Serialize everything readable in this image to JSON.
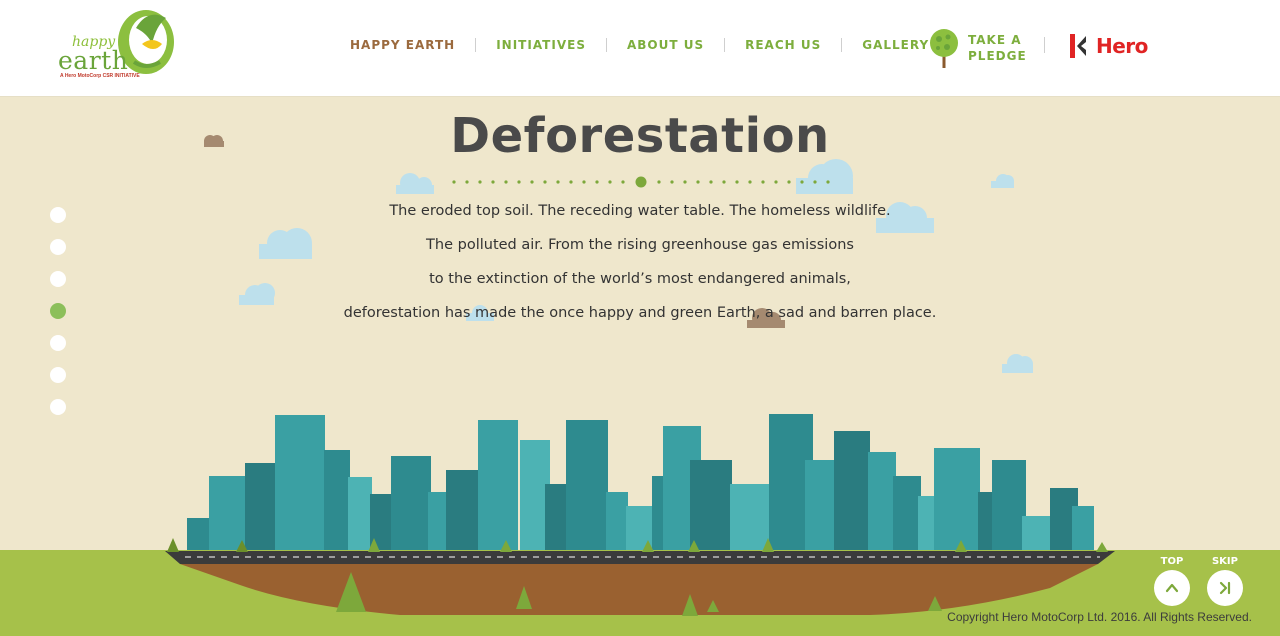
{
  "logo": {
    "word_happy": "happy",
    "word_earth": "earth",
    "tagline": "A Hero MotoCorp CSR INITIATIVE"
  },
  "nav": [
    {
      "label": "HAPPY EARTH",
      "active": true
    },
    {
      "label": "INITIATIVES",
      "active": false
    },
    {
      "label": "ABOUT US",
      "active": false
    },
    {
      "label": "REACH US",
      "active": false
    },
    {
      "label": "GALLERY",
      "active": false
    }
  ],
  "pledge": {
    "line1": "TAKE A",
    "line2": "PLEDGE"
  },
  "hero": {
    "label": "Hero"
  },
  "main": {
    "title": "Deforestation",
    "lines": [
      "The eroded top soil. The receding water table. The homeless wildlife.",
      "The polluted air. From the rising greenhouse gas emissions",
      "to the extinction of the world’s most endangered animals,",
      "deforestation has made the once happy and green Earth, a sad and barren place."
    ]
  },
  "side_nav": {
    "count": 7,
    "active_index": 3
  },
  "buttons": {
    "top_label": "TOP",
    "skip_label": "SKIP"
  },
  "footer": {
    "copyright": "Copyright Hero MotoCorp Ltd. 2016. All Rights Reserved."
  },
  "colors": {
    "background": "#efe7cc",
    "nav_green": "#7dae3d",
    "nav_active": "#9b6a3e",
    "title": "#4a4a4a",
    "building_teal": "#2e8b8f",
    "grass": "#a6c14a",
    "soil": "#9a6130",
    "hero_red": "#e02424"
  },
  "icons": {
    "top": "chevron-up-icon",
    "skip": "skip-forward-icon",
    "pledge": "tree-icon",
    "hero": "hero-logo-icon"
  }
}
